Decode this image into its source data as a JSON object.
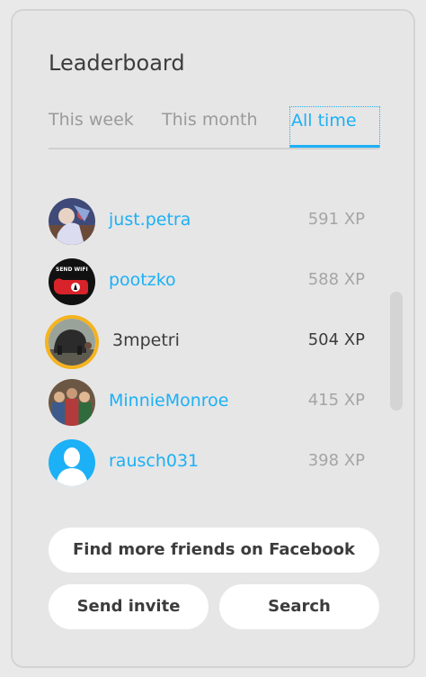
{
  "leaderboard": {
    "title": "Leaderboard",
    "tabs": [
      {
        "label": "This week",
        "active": false
      },
      {
        "label": "This month",
        "active": false
      },
      {
        "label": "All time",
        "active": true
      }
    ],
    "entries": [
      {
        "name": "just.petra",
        "xp": "591 XP",
        "is_self": false,
        "avatar": "photo-avatar"
      },
      {
        "name": "pootzko",
        "xp": "588 XP",
        "is_self": false,
        "avatar": "send-wifi-avatar"
      },
      {
        "name": "3mpetri",
        "xp": "504 XP",
        "is_self": true,
        "avatar": "photo-avatar"
      },
      {
        "name": "MinnieMonroe",
        "xp": "415 XP",
        "is_self": false,
        "avatar": "photo-avatar"
      },
      {
        "name": "rausch031",
        "xp": "398 XP",
        "is_self": false,
        "avatar": "default-user-avatar"
      }
    ],
    "avatar_badge_text": "SEND WIFI"
  },
  "buttons": {
    "facebook": "Find more friends on Facebook",
    "invite": "Send invite",
    "search": "Search"
  },
  "colors": {
    "accent": "#1cb0f6",
    "highlight_ring": "#f5b31f",
    "text": "#3c3c3c",
    "muted": "#a5a5a5"
  }
}
